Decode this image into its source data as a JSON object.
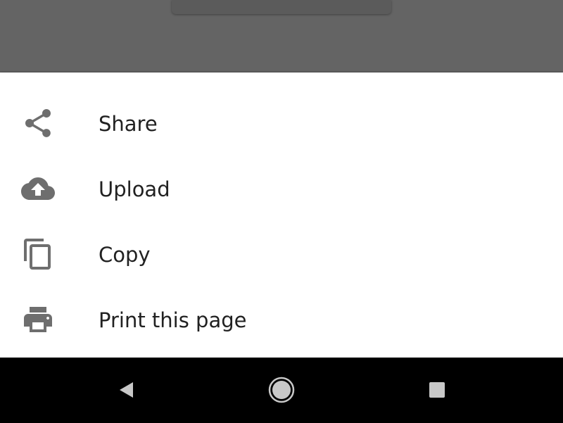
{
  "menu": {
    "items": [
      {
        "label": "Share",
        "icon": "share-icon"
      },
      {
        "label": "Upload",
        "icon": "cloud-upload-icon"
      },
      {
        "label": "Copy",
        "icon": "copy-icon"
      },
      {
        "label": "Print this page",
        "icon": "print-icon"
      }
    ]
  },
  "navbar": {
    "buttons": [
      "back-icon",
      "home-icon",
      "recents-icon"
    ]
  },
  "colors": {
    "icon": "#6e6e6e",
    "label": "#212121",
    "scrim": "#646464",
    "sheet": "#ffffff",
    "navbar": "#000000",
    "nav_icon": "#c8c8c8"
  }
}
